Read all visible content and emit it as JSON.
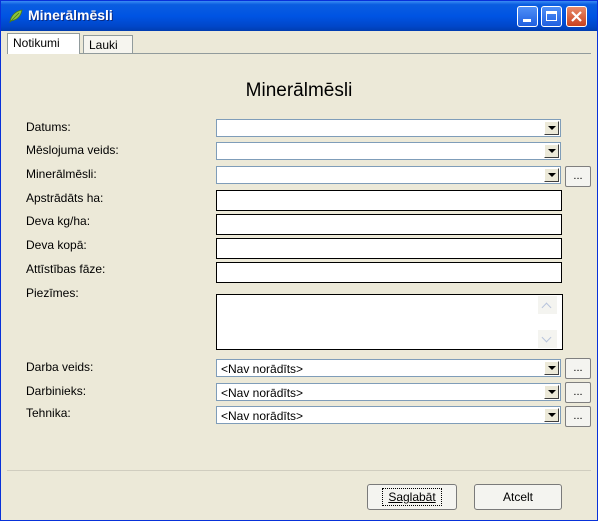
{
  "window": {
    "title": "Minerālmēsli",
    "controls": [
      "minimize-icon",
      "maximize-icon",
      "close-icon"
    ]
  },
  "tabs": [
    {
      "label": "Notikumi",
      "active": true
    },
    {
      "label": "Lauki",
      "active": false
    }
  ],
  "form": {
    "title": "Minerālmēsli",
    "fields": {
      "datums": {
        "label": "Datums:",
        "value": ""
      },
      "meslojuma_veids": {
        "label": "Mēslojuma veids:",
        "value": ""
      },
      "mineralmesli": {
        "label": "Minerālmēsli:",
        "value": ""
      },
      "apstradats_ha": {
        "label": "Apstrādāts ha:",
        "value": ""
      },
      "deva_kg_ha": {
        "label": "Deva kg/ha:",
        "value": ""
      },
      "deva_kopa": {
        "label": "Deva kopā:",
        "value": ""
      },
      "attistibas_faze": {
        "label": "Attīstības fāze:",
        "value": ""
      },
      "piezimes": {
        "label": "Piezīmes:",
        "value": ""
      },
      "darba_veids": {
        "label": "Darba veids:",
        "value": "<Nav norādīts>"
      },
      "darbinieks": {
        "label": "Darbinieks:",
        "value": "<Nav norādīts>"
      },
      "tehnika": {
        "label": "Tehnika:",
        "value": "<Nav norādīts>"
      }
    },
    "browse_label": "..."
  },
  "buttons": {
    "save": "Saglabāt",
    "cancel": "Atcelt"
  },
  "colors": {
    "titlebar": "#0054e3",
    "window_bg": "#ece9d8",
    "close_button": "#c8411f"
  }
}
